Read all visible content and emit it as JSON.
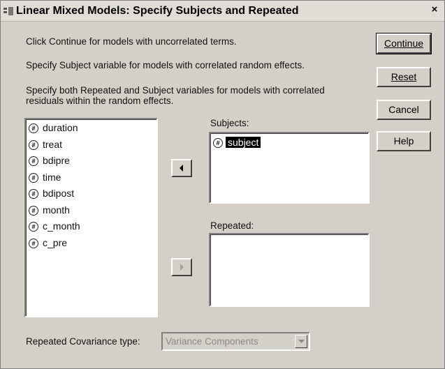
{
  "window": {
    "title": "Linear Mixed Models: Specify Subjects and Repeated",
    "close_label": "×"
  },
  "instructions": {
    "line1": "Click Continue for models with uncorrelated terms.",
    "line2": "Specify Subject variable for models with correlated random effects.",
    "line3a": "Specify both Repeated and Subject variables for models with correlated",
    "line3b": "residuals within the random effects."
  },
  "buttons": {
    "continue": "Continue",
    "reset": "Reset",
    "cancel": "Cancel",
    "help": "Help"
  },
  "variables": [
    {
      "name": "duration"
    },
    {
      "name": "treat"
    },
    {
      "name": "bdipre"
    },
    {
      "name": "time"
    },
    {
      "name": "bdipost"
    },
    {
      "name": "month"
    },
    {
      "name": "c_month"
    },
    {
      "name": "c_pre"
    }
  ],
  "subjects": {
    "label": "Subjects:",
    "items": [
      {
        "name": "subject",
        "selected": true
      }
    ]
  },
  "repeated": {
    "label": "Repeated:",
    "items": []
  },
  "covariance": {
    "label": "Repeated Covariance type:",
    "value": "Variance Components",
    "enabled": false
  },
  "icons": {
    "variable": "scale-variable-icon",
    "move_left": "arrow-left-icon",
    "move_right": "arrow-right-icon",
    "dropdown": "chevron-down-icon",
    "title": "spss-dialog-icon"
  },
  "colors": {
    "dialog_bg": "#d4d0c8",
    "selection": "#000000",
    "disabled_text": "#8a8a8a"
  }
}
